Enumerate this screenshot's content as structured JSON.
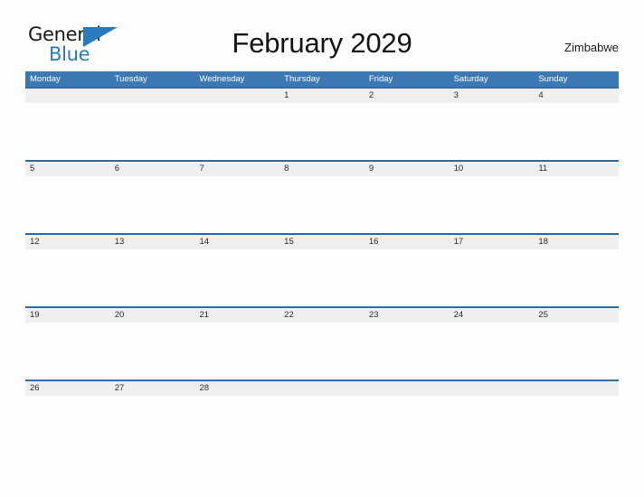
{
  "brand": {
    "name_part1": "General",
    "name_part2": "Blue",
    "flag_icon": "flag-triangle-icon",
    "accent_color": "#2b79bd"
  },
  "header": {
    "title": "February 2029",
    "month": "February",
    "year": "2029",
    "region": "Zimbabwe"
  },
  "calendar": {
    "header_bg_color": "#3c79b4",
    "row_border_color": "#2e6da4",
    "daynum_band_color": "#efefef",
    "weekdays": [
      "Monday",
      "Tuesday",
      "Wednesday",
      "Thursday",
      "Friday",
      "Saturday",
      "Sunday"
    ],
    "weeks": [
      [
        "",
        "",
        "",
        "1",
        "2",
        "3",
        "4"
      ],
      [
        "5",
        "6",
        "7",
        "8",
        "9",
        "10",
        "11"
      ],
      [
        "12",
        "13",
        "14",
        "15",
        "16",
        "17",
        "18"
      ],
      [
        "19",
        "20",
        "21",
        "22",
        "23",
        "24",
        "25"
      ],
      [
        "26",
        "27",
        "28",
        "",
        "",
        "",
        ""
      ]
    ]
  }
}
